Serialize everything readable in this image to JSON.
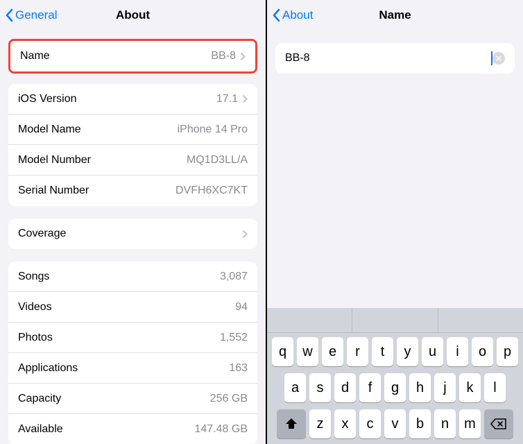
{
  "left": {
    "back_label": "General",
    "title": "About",
    "name_row": {
      "label": "Name",
      "value": "BB-8"
    },
    "info_rows": [
      {
        "label": "iOS Version",
        "value": "17.1",
        "disclosure": true
      },
      {
        "label": "Model Name",
        "value": "iPhone 14 Pro",
        "disclosure": false
      },
      {
        "label": "Model Number",
        "value": "MQ1D3LL/A",
        "disclosure": false
      },
      {
        "label": "Serial Number",
        "value": "DVFH6XC7KT",
        "disclosure": false
      }
    ],
    "coverage_label": "Coverage",
    "stats_rows": [
      {
        "label": "Songs",
        "value": "3,087"
      },
      {
        "label": "Videos",
        "value": "94"
      },
      {
        "label": "Photos",
        "value": "1,552"
      },
      {
        "label": "Applications",
        "value": "163"
      },
      {
        "label": "Capacity",
        "value": "256 GB"
      },
      {
        "label": "Available",
        "value": "147.48 GB"
      }
    ]
  },
  "right": {
    "back_label": "About",
    "title": "Name",
    "input_value": "BB-8",
    "keyboard": {
      "row1": [
        "q",
        "w",
        "e",
        "r",
        "t",
        "y",
        "u",
        "i",
        "o",
        "p"
      ],
      "row2": [
        "a",
        "s",
        "d",
        "f",
        "g",
        "h",
        "j",
        "k",
        "l"
      ],
      "row3": [
        "z",
        "x",
        "c",
        "v",
        "b",
        "n",
        "m"
      ]
    }
  }
}
